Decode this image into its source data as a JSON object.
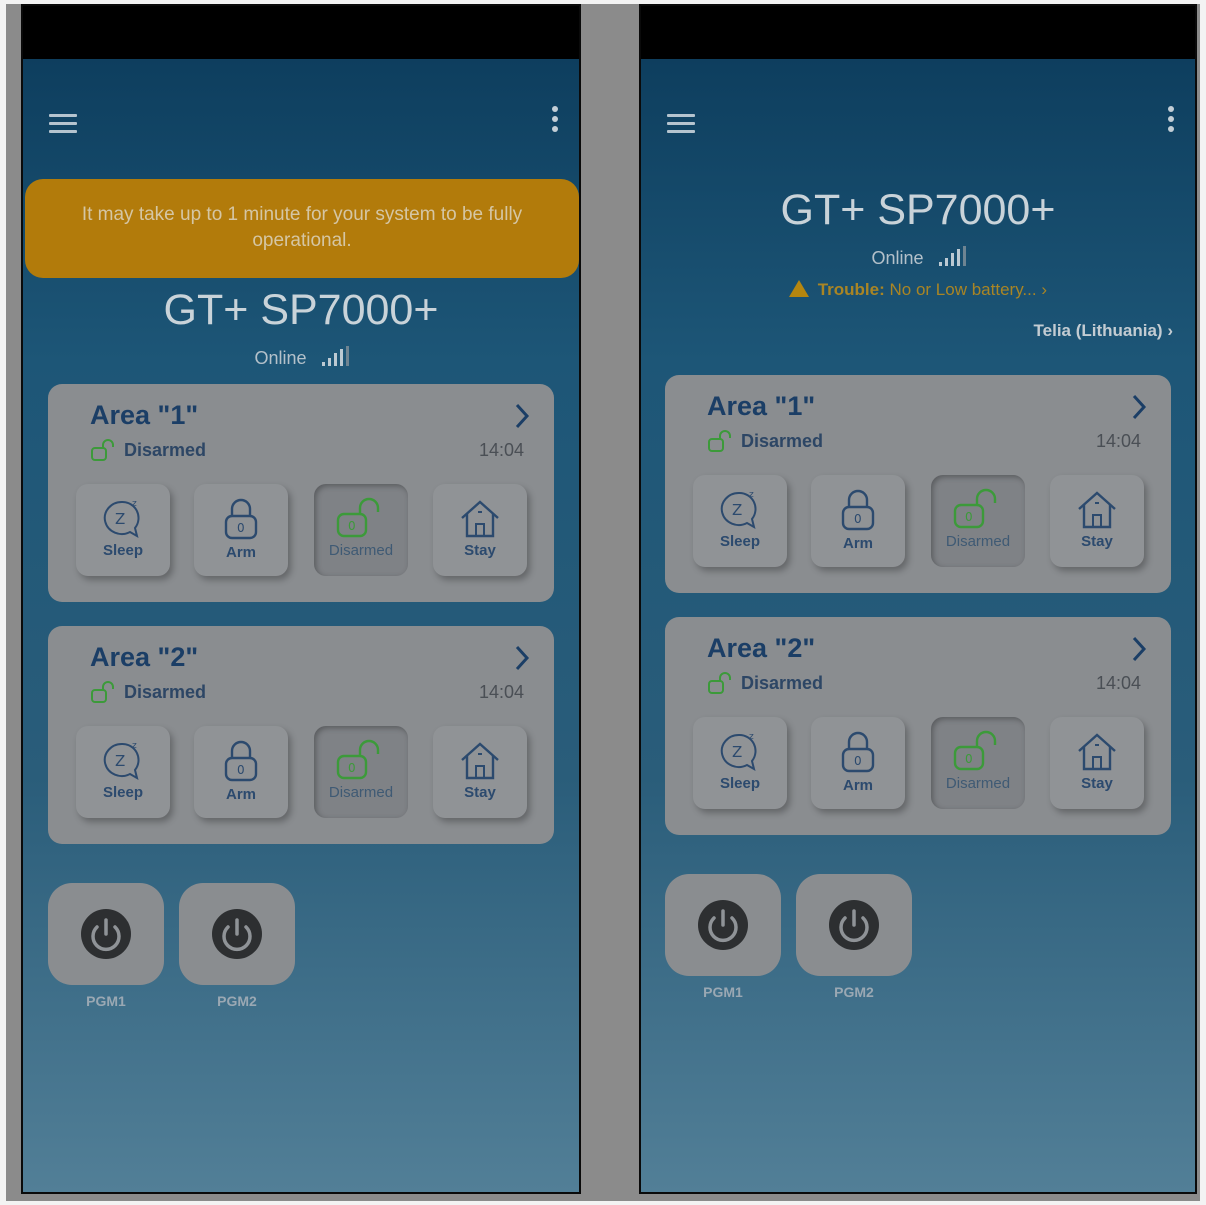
{
  "left": {
    "banner": "It may take up to 1 minute for your system to be fully operational.",
    "device_name": "GT+ SP7000+",
    "status": "Online",
    "areas": [
      {
        "name": "Area \"1\"",
        "state": "Disarmed",
        "time": "14:04"
      },
      {
        "name": "Area \"2\"",
        "state": "Disarmed",
        "time": "14:04"
      }
    ],
    "pgms": [
      "PGM1",
      "PGM2"
    ]
  },
  "right": {
    "device_name": "GT+ SP7000+",
    "status": "Online",
    "trouble_label": "Trouble:",
    "trouble_text": "No or Low battery...",
    "carrier": "Telia (Lithuania)",
    "areas": [
      {
        "name": "Area \"1\"",
        "state": "Disarmed",
        "time": "14:04"
      },
      {
        "name": "Area \"2\"",
        "state": "Disarmed",
        "time": "14:04"
      }
    ],
    "pgms": [
      "PGM1",
      "PGM2"
    ]
  },
  "modes": [
    "Sleep",
    "Arm",
    "Disarmed",
    "Stay"
  ],
  "icons": {
    "menu": "hamburger-menu-icon",
    "more": "kebab-more-icon",
    "signal": "signal-bars-icon",
    "warning": "warning-triangle-icon",
    "chevron": "chevron-right-icon",
    "sleep": "sleep-bubble-icon",
    "arm": "lock-closed-icon",
    "disarm": "lock-open-icon",
    "stay": "house-icon",
    "power": "power-icon"
  },
  "colors": {
    "banner": "#b27b0b",
    "area_title": "#1b3e66",
    "disarmed_green": "#3c9a3a",
    "trouble": "#b5860f"
  }
}
